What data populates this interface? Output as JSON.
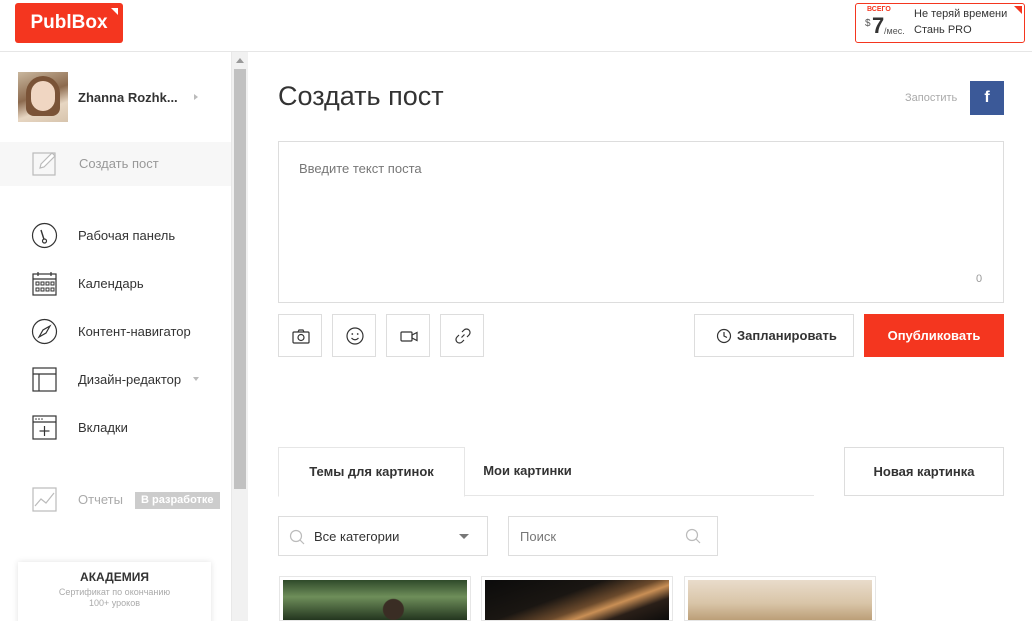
{
  "brand": {
    "logo_text": "PublBox",
    "accent": "#f4361f"
  },
  "promo": {
    "prefix": "ВСЕГО",
    "currency": "$",
    "price": "7",
    "period": "/мес.",
    "line1": "Не теряй времени",
    "line2": "Стань PRO"
  },
  "user": {
    "name": "Zhanna Rozhk..."
  },
  "sidebar": {
    "create_label": "Создать пост",
    "items": [
      {
        "label": "Рабочая панель",
        "icon": "dashboard-gauge-icon"
      },
      {
        "label": "Календарь",
        "icon": "calendar-icon"
      },
      {
        "label": "Контент-навигатор",
        "icon": "compass-icon"
      },
      {
        "label": "Дизайн-редактор",
        "icon": "layout-icon"
      },
      {
        "label": "Вкладки",
        "icon": "tab-add-icon"
      }
    ],
    "reports": {
      "label": "Отчеты",
      "badge": "В разработке"
    }
  },
  "academy": {
    "title": "АКАДЕМИЯ",
    "subtitle1": "Сертификат по окончанию",
    "subtitle2": "100+ уроков"
  },
  "main": {
    "title": "Создать пост",
    "post_link": "Запостить",
    "fb_label": "f",
    "post_placeholder": "Введите текст поста",
    "char_count": "0",
    "schedule_label": "Запланировать",
    "publish_label": "Опубликовать"
  },
  "images": {
    "tabs": [
      "Темы для картинок",
      "Мои картинки"
    ],
    "new_button": "Новая картинка",
    "category_select": "Все категории",
    "search_placeholder": "Поиск"
  }
}
